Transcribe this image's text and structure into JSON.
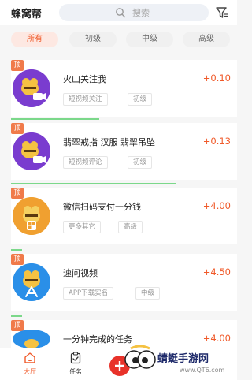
{
  "app": {
    "title": "蜂窝帮",
    "search_placeholder": "搜索",
    "accent_color": "#f05a2a"
  },
  "tabs": [
    {
      "label": "所有",
      "active": true
    },
    {
      "label": "初级",
      "active": false
    },
    {
      "label": "中级",
      "active": false
    },
    {
      "label": "高级",
      "active": false
    }
  ],
  "tasks": [
    {
      "badge": "顶",
      "title": "火山关注我",
      "tags": [
        "短视频关注",
        "初级"
      ],
      "reward": "+0.10",
      "icon": "bee-video-icon"
    },
    {
      "badge": "顶",
      "title": "翡翠戒指 汉服 翡翠吊坠",
      "tags": [
        "短视频评论",
        "初级"
      ],
      "reward": "+0.13",
      "icon": "bee-video-icon"
    },
    {
      "badge": "顶",
      "title": "微信扫码支付一分钱",
      "tags": [
        "更多其它",
        "高级"
      ],
      "reward": "+4.00",
      "icon": "bee-grid-icon"
    },
    {
      "badge": "顶",
      "title": "速问视频",
      "tags": [
        "APP下载实名",
        "中级"
      ],
      "reward": "+4.50",
      "icon": "bee-appstore-icon"
    },
    {
      "badge": "顶",
      "title": "一分钟完成的任务",
      "tags": [],
      "reward": "+4.00",
      "icon": "bee-icon"
    }
  ],
  "bottom_nav": [
    {
      "label": "大厅",
      "active": true,
      "icon": "home-icon"
    },
    {
      "label": "任务",
      "active": false,
      "icon": "task-clipboard-icon"
    }
  ],
  "watermark": {
    "text": "蜻蜓手游网",
    "url": "www.QT6.com"
  }
}
